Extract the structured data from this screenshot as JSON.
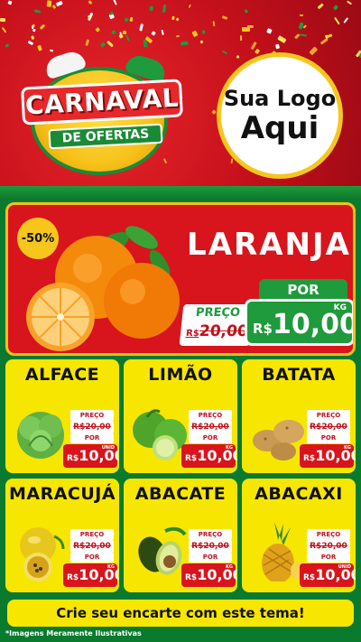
{
  "header": {
    "event_title": "CARNAVAL",
    "event_subtitle": "DE OFERTAS",
    "logo_line1": "Sua Logo",
    "logo_line2": "Aqui"
  },
  "featured": {
    "discount": "-50%",
    "name": "LARANJA",
    "preco_label": "PREÇO",
    "old_price_prefix": "R$",
    "old_price": "20,00",
    "por_label": "POR",
    "new_price_prefix": "R$",
    "new_price": "10,00",
    "unit": "KG"
  },
  "products": [
    {
      "name": "ALFACE",
      "preco_label": "PREÇO",
      "old_price": "R$20,00",
      "por_label": "POR",
      "prefix": "R$",
      "price": "10,00",
      "unit": "UNID"
    },
    {
      "name": "LIMÃO",
      "preco_label": "PREÇO",
      "old_price": "R$20,00",
      "por_label": "POR",
      "prefix": "R$",
      "price": "10,00",
      "unit": "KG"
    },
    {
      "name": "BATATA",
      "preco_label": "PREÇO",
      "old_price": "R$20,00",
      "por_label": "POR",
      "prefix": "R$",
      "price": "10,00",
      "unit": "KG"
    },
    {
      "name": "MARACUJÁ",
      "preco_label": "PREÇO",
      "old_price": "R$20,00",
      "por_label": "POR",
      "prefix": "R$",
      "price": "10,00",
      "unit": "KG"
    },
    {
      "name": "ABACATE",
      "preco_label": "PREÇO",
      "old_price": "R$20,00",
      "por_label": "POR",
      "prefix": "R$",
      "price": "10,00",
      "unit": "KG"
    },
    {
      "name": "ABACAXI",
      "preco_label": "PREÇO",
      "old_price": "R$20,00",
      "por_label": "POR",
      "prefix": "R$",
      "price": "10,00",
      "unit": "UNID"
    }
  ],
  "cta": "Crie seu encarte com este tema!",
  "disclaimer": "*Imagens Meramente Ilustrativas",
  "colors": {
    "header_red": "#c4101b",
    "promo_green": "#1f9a3c",
    "card_yellow": "#f7e600",
    "price_red": "#d8141c",
    "gold": "#f6c61d"
  },
  "icons": {
    "featured": "orange-fruit-icon",
    "products": [
      "lettuce-icon",
      "lime-icon",
      "potato-icon",
      "passion-fruit-icon",
      "avocado-icon",
      "pineapple-icon"
    ]
  }
}
